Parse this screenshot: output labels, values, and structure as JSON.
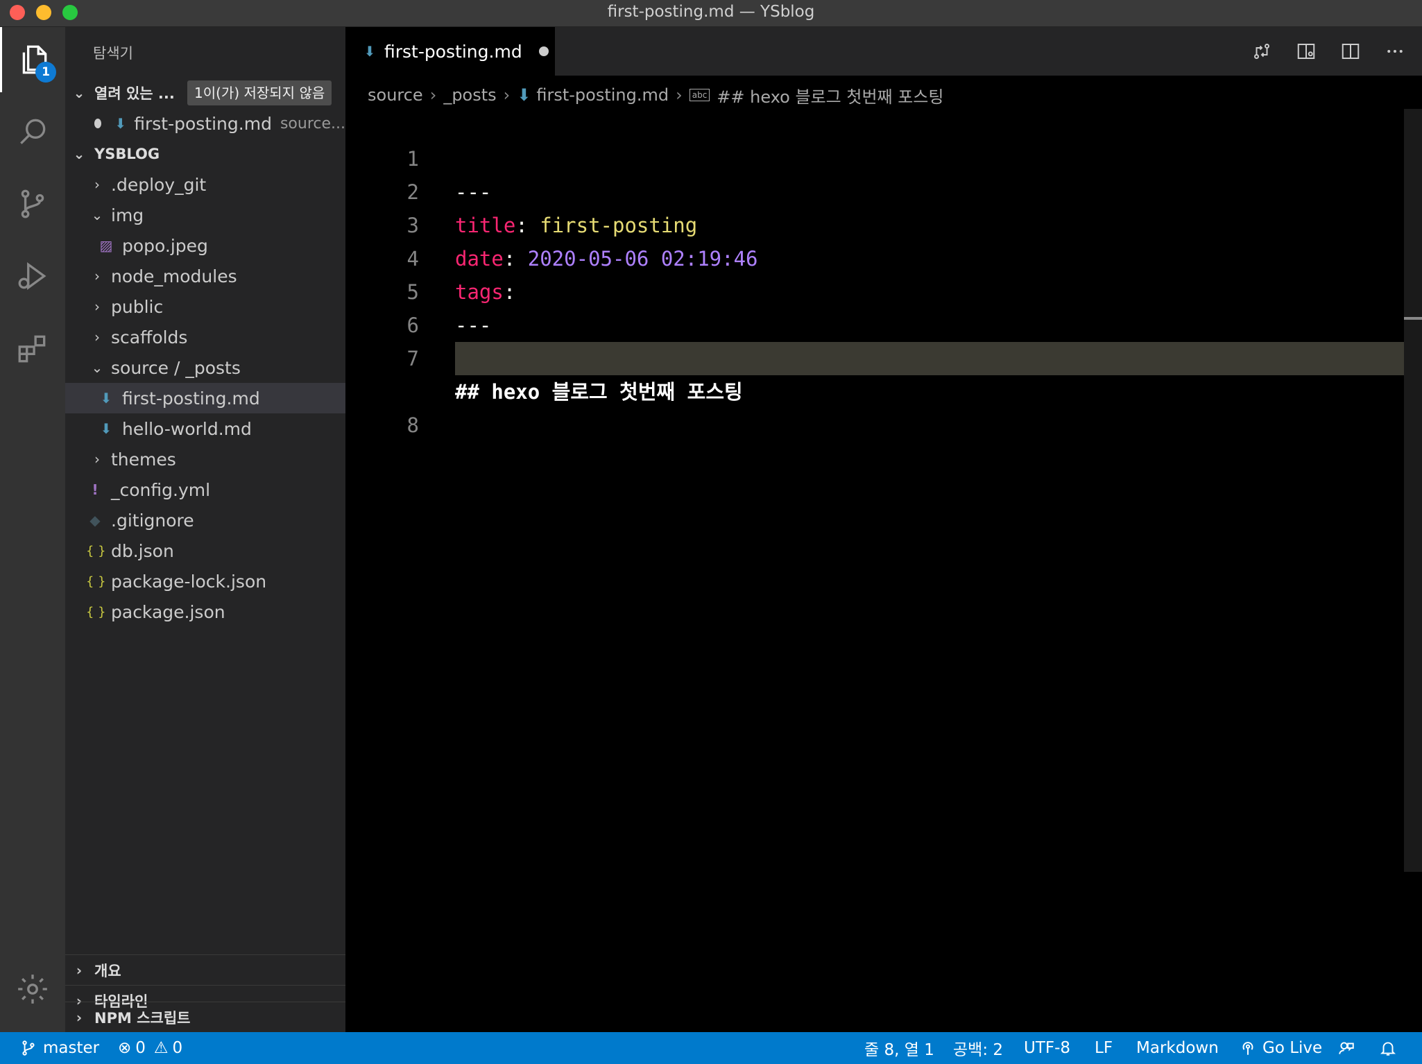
{
  "window": {
    "title": "first-posting.md — YSblog"
  },
  "activity": {
    "explorer_badge": "1"
  },
  "sidebar": {
    "header": "탐색기",
    "open_editors": {
      "label": "열려 있는 ...",
      "unsaved": "1이(가) 저장되지 않음",
      "file": "first-posting.md",
      "path": "source..."
    },
    "project": "YSBLOG",
    "tree": [
      {
        "label": ".deploy_git"
      },
      {
        "label": "img"
      },
      {
        "label": "popo.jpeg"
      },
      {
        "label": "node_modules"
      },
      {
        "label": "public"
      },
      {
        "label": "scaffolds"
      },
      {
        "label": "source / _posts"
      },
      {
        "label": "first-posting.md"
      },
      {
        "label": "hello-world.md"
      },
      {
        "label": "themes"
      },
      {
        "label": "_config.yml"
      },
      {
        "label": ".gitignore"
      },
      {
        "label": "db.json"
      },
      {
        "label": "package-lock.json"
      },
      {
        "label": "package.json"
      }
    ],
    "panels": [
      {
        "label": "개요"
      },
      {
        "label": "타임라인"
      },
      {
        "label": "NPM 스크립트"
      }
    ]
  },
  "editor": {
    "tab": "first-posting.md",
    "breadcrumb": [
      "source",
      "_posts",
      "first-posting.md",
      "## hexo 블로그 첫번째 포스팅"
    ],
    "lines": {
      "l1": "---",
      "l2_key": "title",
      "l2_colon": ": ",
      "l2_val": "first-posting",
      "l3_key": "date",
      "l3_colon": ": ",
      "l3_val": "2020-05-06 02:19:46",
      "l4_key": "tags",
      "l4_colon": ":",
      "l5": "---",
      "l7": "## hexo 블로그 첫번째 포스팅"
    },
    "line_numbers": [
      "1",
      "2",
      "3",
      "4",
      "5",
      "6",
      "7",
      "8"
    ]
  },
  "status": {
    "branch": "master",
    "errors": "0",
    "warnings": "0",
    "position": "줄 8, 열 1",
    "spaces": "공백: 2",
    "encoding": "UTF-8",
    "eol": "LF",
    "language": "Markdown",
    "golive": "Go Live"
  },
  "colors": {
    "statusbar": "#007acc",
    "sidebar": "#252526",
    "activitybar": "#333333"
  }
}
